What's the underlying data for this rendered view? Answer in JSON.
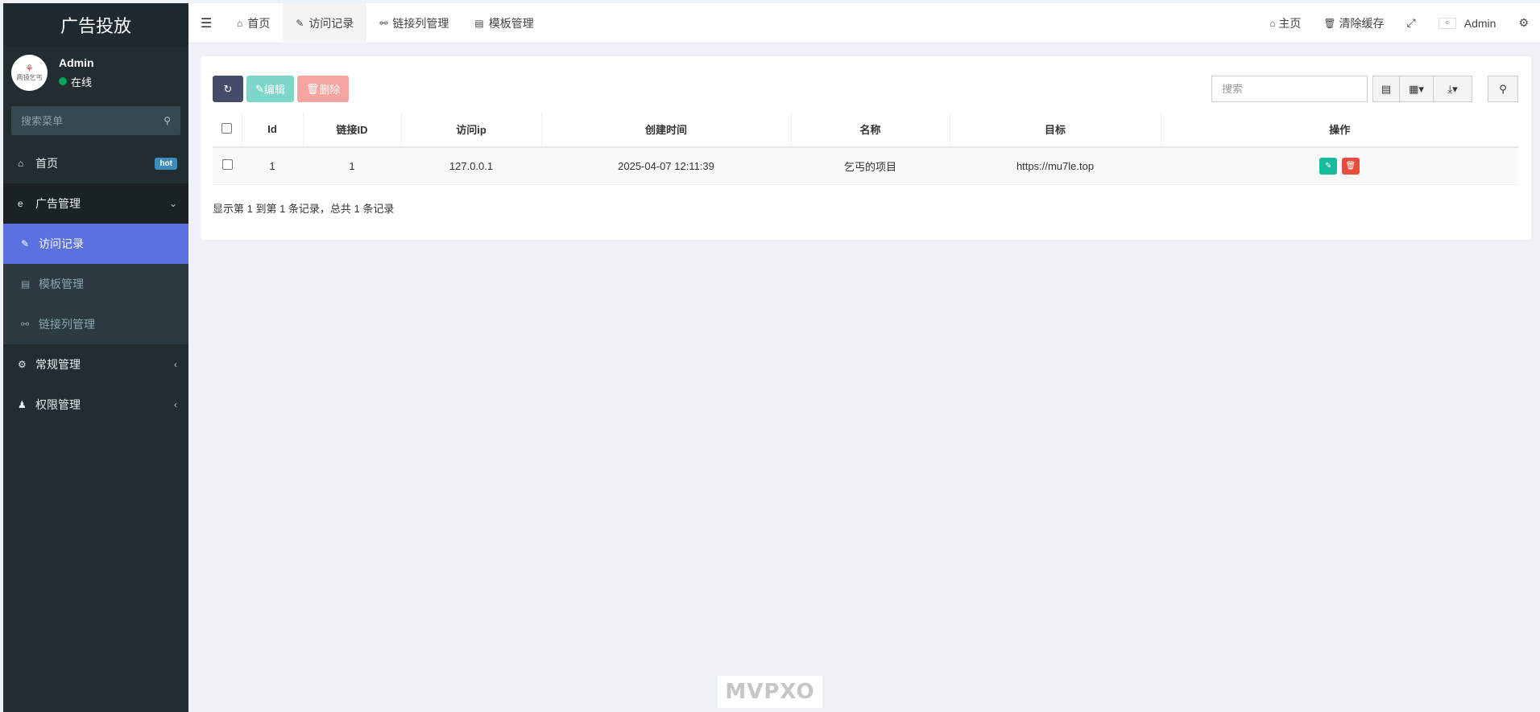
{
  "sidebar": {
    "brand": "广告投放",
    "user": {
      "avatar_text": "两镜乞丐",
      "name": "Admin",
      "status": "在线"
    },
    "search_placeholder": "搜索菜单",
    "items": [
      {
        "label": "首页",
        "badge": "hot"
      },
      {
        "label": "广告管理",
        "open": true,
        "children": [
          {
            "label": "访问记录",
            "active": true
          },
          {
            "label": "模板管理"
          },
          {
            "label": "链接列管理"
          }
        ]
      },
      {
        "label": "常规管理"
      },
      {
        "label": "权限管理"
      }
    ]
  },
  "topbar": {
    "tabs": [
      {
        "label": "首页"
      },
      {
        "label": "访问记录",
        "active": true
      },
      {
        "label": "链接列管理"
      },
      {
        "label": "模板管理"
      }
    ],
    "links": {
      "home": "主页",
      "clear_cache": "清除缓存",
      "admin": "Admin"
    }
  },
  "toolbar": {
    "edit_label": "编辑",
    "delete_label": "删除",
    "search_placeholder": "搜索"
  },
  "table": {
    "columns": [
      "Id",
      "链接ID",
      "访问ip",
      "创建时间",
      "名称",
      "目标",
      "操作"
    ],
    "rows": [
      {
        "id": "1",
        "link_id": "1",
        "ip": "127.0.0.1",
        "created": "2025-04-07 12:11:39",
        "name": "乞丐的项目",
        "target": "https://mu7le.top"
      }
    ]
  },
  "pagination": {
    "info": "显示第 1 到第 1 条记录，总共 1 条记录"
  },
  "watermark": "MVPXO"
}
